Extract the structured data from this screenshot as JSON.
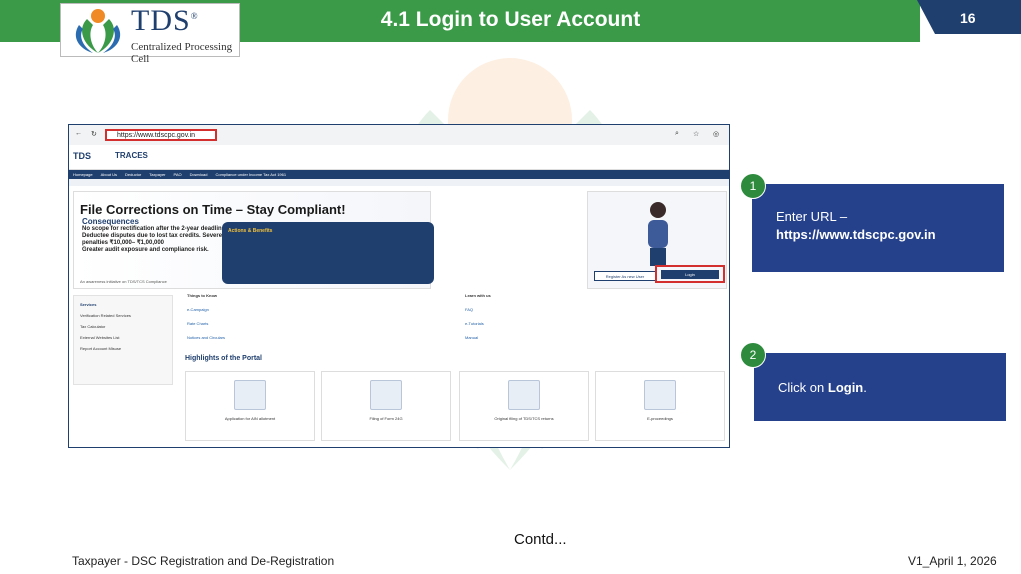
{
  "header": {
    "title": "4.1 Login to User Account",
    "page_number": "16",
    "colors": {
      "green": "#3a9a48",
      "navy": "#1f3f6e"
    }
  },
  "logo": {
    "brand": "TDS",
    "registered": "®",
    "subtitle": "Centralized Processing Cell"
  },
  "screenshot": {
    "url": "https://www.tdscpc.gov.in",
    "site_name": "TRACES",
    "nav_items": [
      "Homepage",
      "About Us",
      "Deductor",
      "Taxpayer",
      "PAO",
      "Download",
      "Compliance under Income Tax Act 1961"
    ],
    "banner": {
      "title": "File Corrections on Time – Stay Compliant!",
      "consequences_label": "Consequences",
      "bullets": [
        "No scope for rectification after the 2-year deadline.",
        "Deductee disputes due to lost tax credits. Severe penalties ₹10,000– ₹1,00,000",
        "Greater audit exposure and compliance risk."
      ],
      "box_title": "Actions & Benefits",
      "footer": "An awareness initiative on TDS/TCS Compliance"
    },
    "register_label": "Register As new User",
    "login_label": "Login",
    "services_title": "Services",
    "services": [
      "Verification Related Services",
      "Tax Calculator",
      "External Websites List",
      "Report Account Misuse"
    ],
    "things_to_know": {
      "title": "Things to Know",
      "items": [
        "e-Campaign",
        "Rate Charts",
        "Notices and Circulars"
      ]
    },
    "learn_with_us": {
      "title": "Learn with us",
      "items": [
        "FAQ",
        "e-Tutorials",
        "Manual"
      ]
    },
    "highlights_title": "Highlights of the Portal",
    "highlights": [
      "Application for AIN allotment",
      "Filing of Form 24G",
      "Original filing of TDS/TCS returns",
      "E-proceedings"
    ]
  },
  "steps": [
    {
      "number": "1",
      "text": "Enter URL –",
      "bold": "https://www.tdscpc.gov.in"
    },
    {
      "number": "2",
      "text": "Click on",
      "bold": "Login",
      "suffix": "."
    }
  ],
  "contd": "Contd...",
  "footer": {
    "left": "Taxpayer - DSC Registration and De-Registration",
    "right": "V1_April 1, 2026"
  }
}
